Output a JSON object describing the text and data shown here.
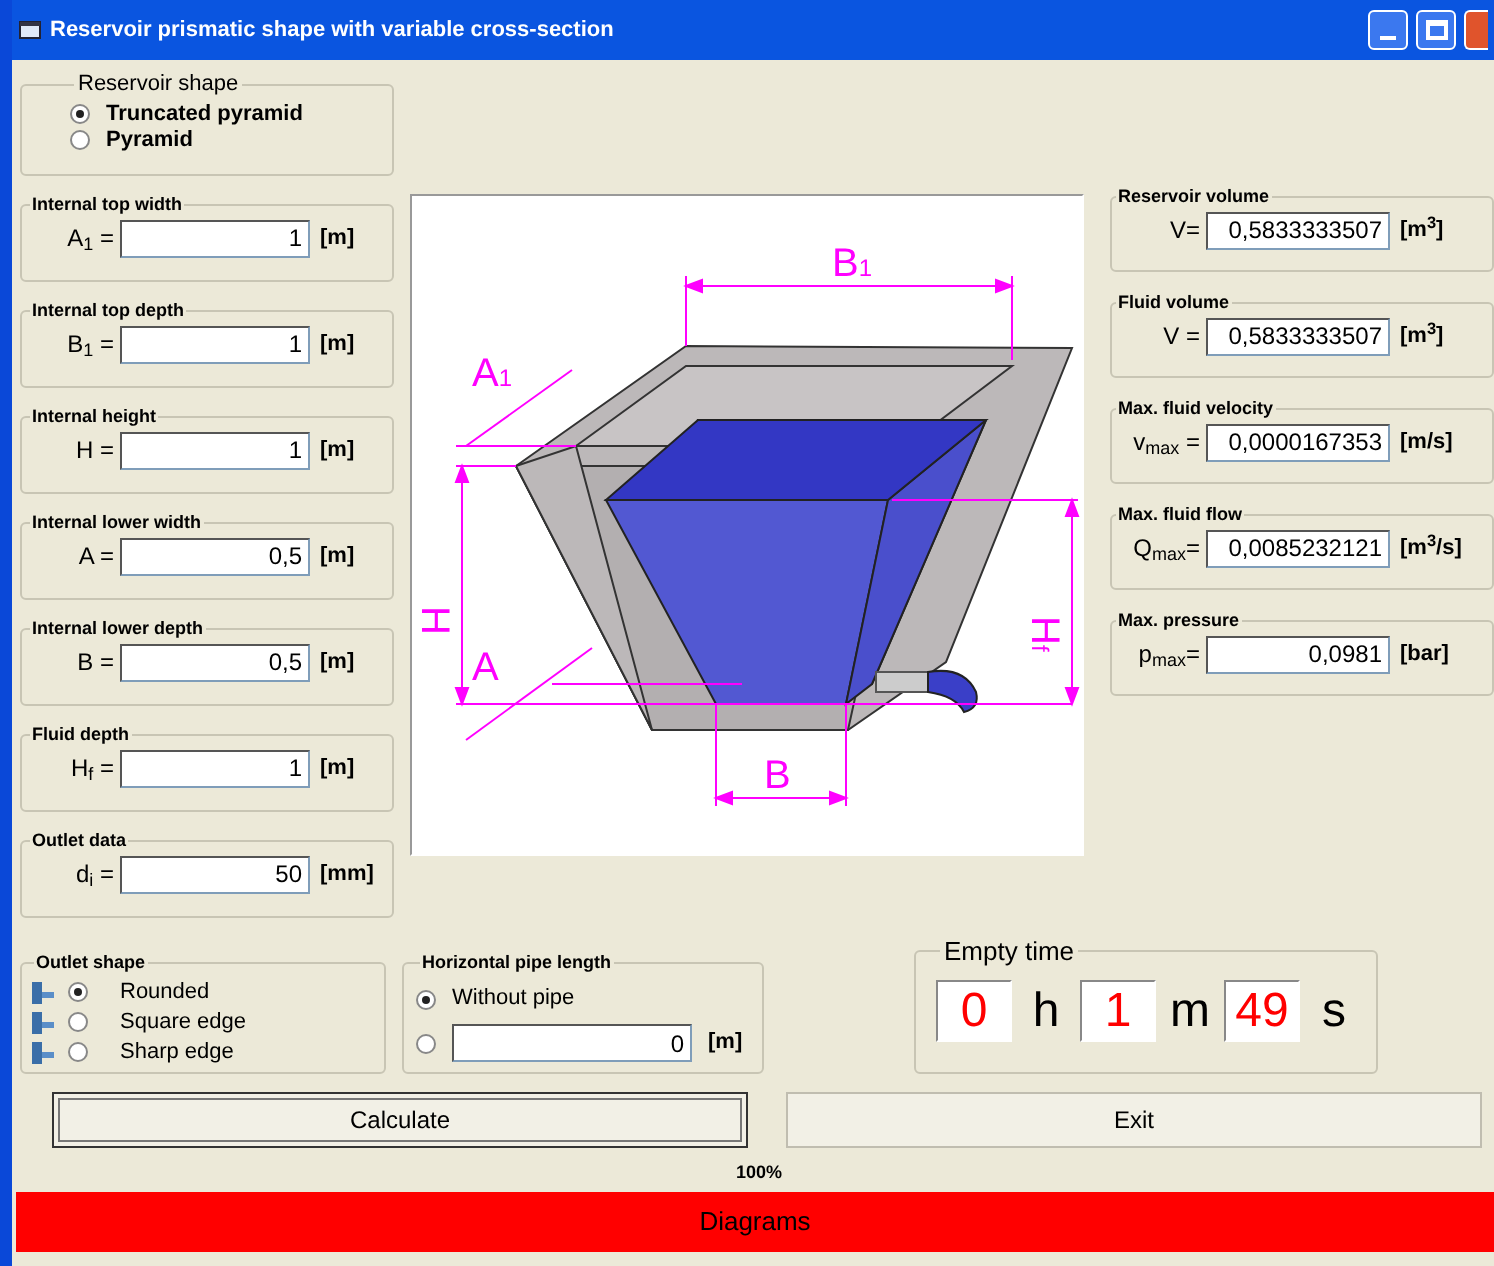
{
  "window": {
    "title": "Reservoir prismatic shape with variable cross-section"
  },
  "reservoir_shape": {
    "title": "Reservoir shape",
    "options": [
      {
        "label": "Truncated pyramid",
        "selected": true
      },
      {
        "label": "Pyramid",
        "selected": false
      }
    ]
  },
  "inputs": [
    {
      "title": "Internal top width",
      "symbol": "A$_{1}$ =",
      "value": "1",
      "unit": "[m]"
    },
    {
      "title": "Internal top depth",
      "symbol": "B$_{1}$ =",
      "value": "1",
      "unit": "[m]"
    },
    {
      "title": "Internal height",
      "symbol": "H =",
      "value": "1",
      "unit": "[m]"
    },
    {
      "title": "Internal lower width",
      "symbol": "A =",
      "value": "0,5",
      "unit": "[m]"
    },
    {
      "title": "Internal lower depth",
      "symbol": "B =",
      "value": "0,5",
      "unit": "[m]"
    },
    {
      "title": "Fluid depth",
      "symbol": "H$_{f}$ =",
      "value": "1",
      "unit": "[m]"
    },
    {
      "title": "Outlet data",
      "symbol": "d$_{i}$ =",
      "value": "50",
      "unit": "[mm]"
    }
  ],
  "diagram": {
    "labels": [
      {
        "text": "B$_{1}$"
      },
      {
        "text": "A$_{1}$"
      },
      {
        "text": "H"
      },
      {
        "text": "H$_{f}$"
      },
      {
        "text": "A"
      },
      {
        "text": "B"
      }
    ]
  },
  "results": [
    {
      "title": "Reservoir volume",
      "symbol": "V=",
      "value": "0,5833333507",
      "unit": "[m$^{3}$]"
    },
    {
      "title": "Fluid volume",
      "symbol": "V =",
      "value": "0,5833333507",
      "unit": "[m$^{3}$]"
    },
    {
      "title": "Max. fluid velocity",
      "symbol": "v$_{max}$ =",
      "value": "0,0000167353",
      "unit": "[m/s]"
    },
    {
      "title": "Max. fluid flow",
      "symbol": "Q$_{max}$=",
      "value": "0,0085232121",
      "unit": "[m$^{3}$/s]"
    },
    {
      "title": "Max. pressure",
      "symbol": "p$_{max}$=",
      "value": "0,0981",
      "unit": "[bar]"
    }
  ],
  "outlet_shape": {
    "title": "Outlet shape",
    "options": [
      {
        "label": "Rounded",
        "selected": true
      },
      {
        "label": "Square edge",
        "selected": false
      },
      {
        "label": "Sharp edge",
        "selected": false
      }
    ]
  },
  "pipe_length": {
    "title": "Horizontal pipe length",
    "options": [
      {
        "label": "Without pipe",
        "selected": true
      },
      {
        "kind": "input",
        "value": "0",
        "unit": "[m]",
        "selected": false
      }
    ]
  },
  "empty_time": {
    "title": "Empty time",
    "parts": [
      {
        "value": "0",
        "unit": "h"
      },
      {
        "value": "1",
        "unit": "m"
      },
      {
        "value": "49",
        "unit": "s"
      }
    ]
  },
  "buttons": [
    {
      "label": "Calculate",
      "focused": true
    },
    {
      "label": "Exit",
      "focused": false
    }
  ],
  "progress": "100%",
  "diagrams_button": "Diagrams"
}
